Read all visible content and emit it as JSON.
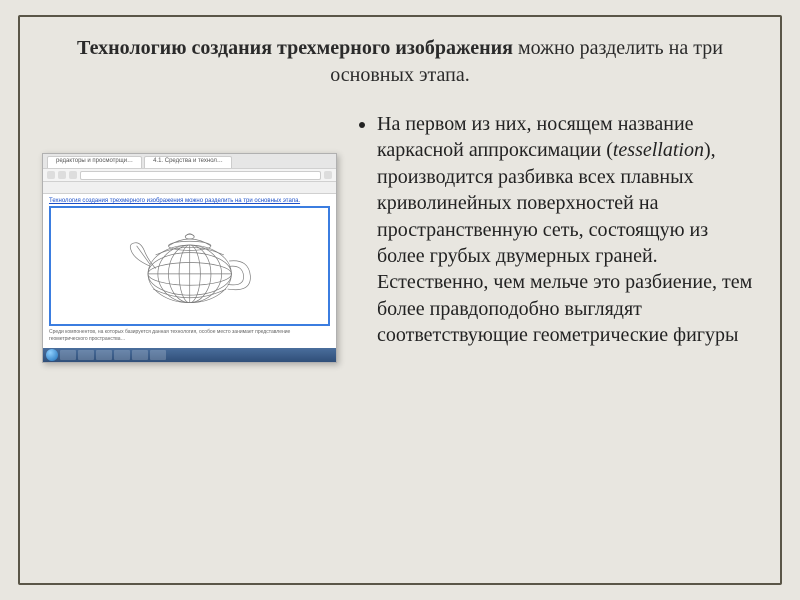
{
  "title": {
    "bold_part": "Технологию создания трехмерного изображения",
    "rest": " можно разделить на три основных этапа."
  },
  "bullet": {
    "part1": "На первом из них, носящем название каркасной аппроксимации (",
    "italic": "tessellation",
    "part2": "), производится разбивка всех плавных криволинейных поверхностей на пространственную сеть, состоящую из более грубых двумерных граней. Естественно, чем мельче это разбиение, тем более правдоподобно выглядят соответствующие геометрические фигуры"
  },
  "browser": {
    "tab1": "редакторы и просмотрщи…",
    "tab2": "4.1. Средства и технол…",
    "page_heading": "Технология создания трехмерного изображения можно разделить на три основных этапа.",
    "page_footer": "Среди компонентов, на которых базируется данная технология, особое место занимает представление геометрического пространства…"
  }
}
